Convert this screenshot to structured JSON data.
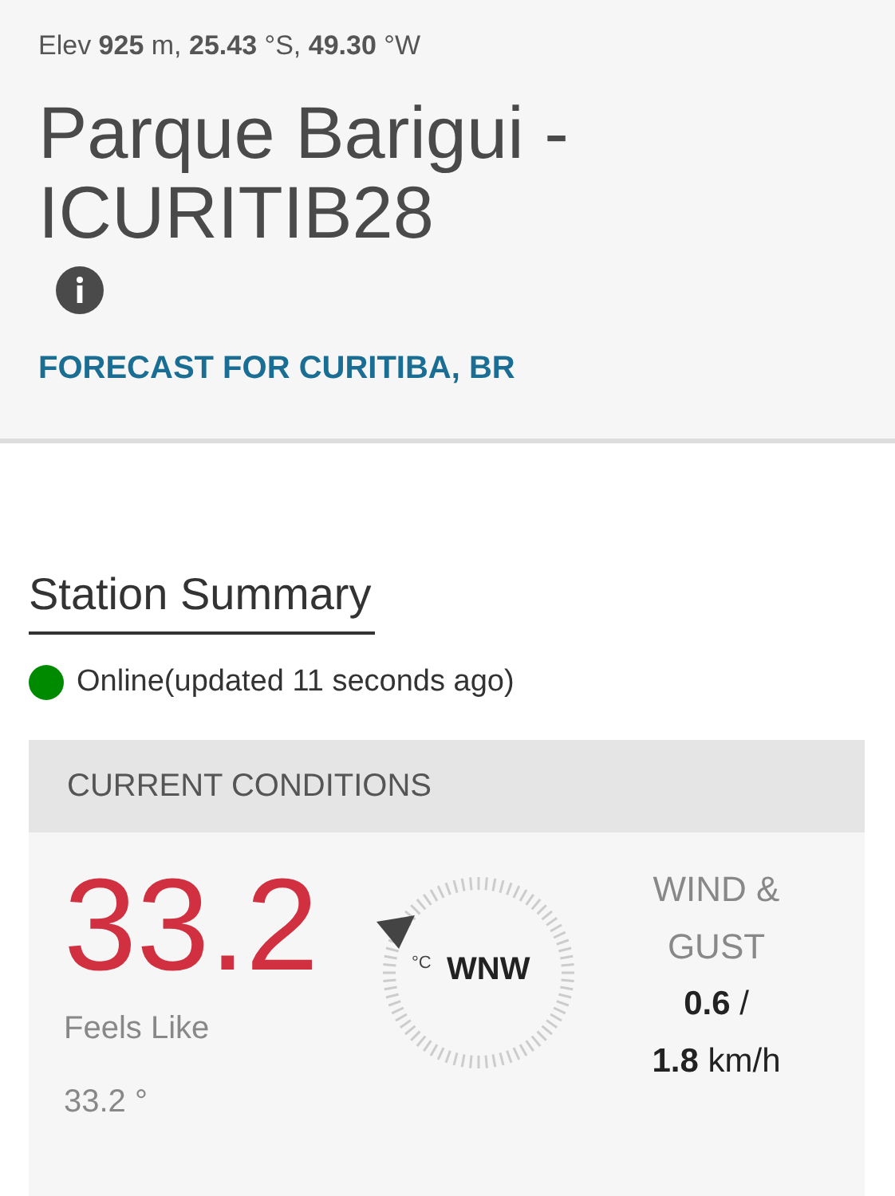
{
  "station": {
    "location": "Elev **925** m, **25.43** °S, **49.30** °W",
    "name": "Parque Barigui - ICURITIB28",
    "forecast_link": "FORECAST FOR CURITIBA, BR"
  },
  "summary": {
    "heading": "Station Summary",
    "status": {
      "text": "Online(updated 11 seconds ago)",
      "color": "#008a00"
    }
  },
  "conditions": {
    "heading": "CURRENT CONDITIONS",
    "temperature": "33.2",
    "feels_like_label": "Feels Like",
    "feels_like": "33.2 °",
    "unit": "°C",
    "wind_direction": "WNW",
    "wind_label": "WIND & GUST",
    "wind": "**0.6**  /",
    "gust": "**1.8** km/h"
  }
}
